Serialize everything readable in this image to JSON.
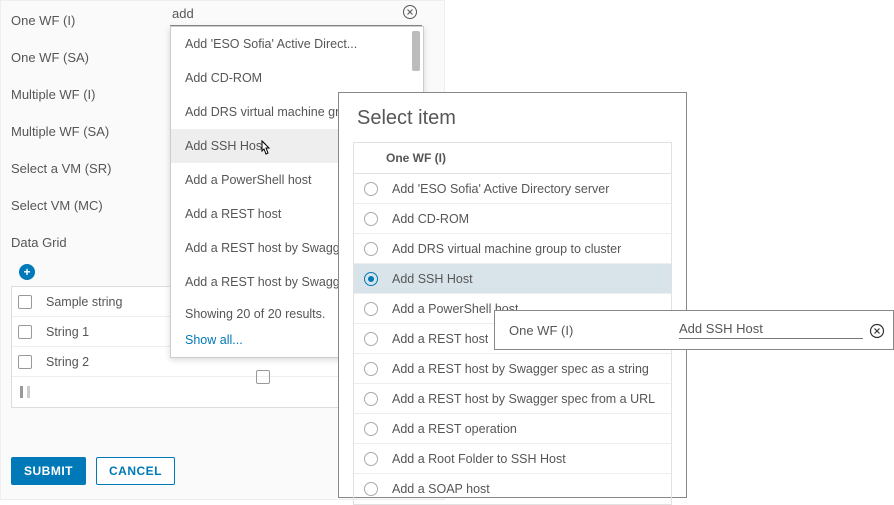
{
  "nav": {
    "items": [
      "One WF (I)",
      "One WF (SA)",
      "Multiple WF (I)",
      "Multiple WF (SA)",
      "Select a VM (SR)",
      "Select VM (MC)",
      "Data Grid"
    ]
  },
  "add_icon_glyph": "+",
  "table": {
    "header": "Sample string",
    "rows": [
      "String 1",
      "String 2"
    ]
  },
  "buttons": {
    "submit": "SUBMIT",
    "cancel": "CANCEL"
  },
  "autocomplete": {
    "value": "add",
    "items": [
      "Add 'ESO Sofia' Active Direct...",
      "Add CD-ROM",
      "Add DRS virtual machine gro...",
      "Add SSH Host",
      "Add a PowerShell host",
      "Add a REST host",
      "Add a REST host by Swagger",
      "Add a REST host by Swagger"
    ],
    "hovered_index": 3,
    "results_text": "Showing 20 of 20 results.",
    "show_all": "Show all..."
  },
  "dialog": {
    "title": "Select item",
    "header": "One WF (I)",
    "items": [
      "Add 'ESO Sofia' Active Directory server",
      "Add CD-ROM",
      "Add DRS virtual machine group to cluster",
      "Add SSH Host",
      "Add a PowerShell host",
      "Add a REST host",
      "Add a REST host by Swagger spec as a string",
      "Add a REST host by Swagger spec from a URL",
      "Add a REST operation",
      "Add a Root Folder to SSH Host",
      "Add a SOAP host"
    ],
    "selected_index": 3
  },
  "chip": {
    "label": "One WF (I)",
    "value": "Add SSH Host"
  }
}
